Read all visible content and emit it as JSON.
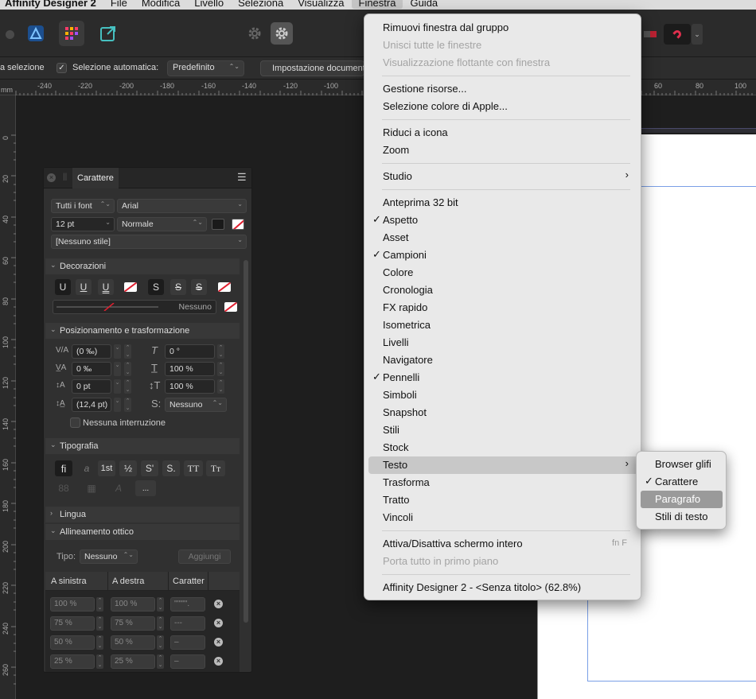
{
  "menubar": {
    "app": "Affinity Designer 2",
    "items": [
      "File",
      "Modifica",
      "Livello",
      "Seleziona",
      "Visualizza",
      "Finestra",
      "Guida"
    ]
  },
  "context_bar": {
    "selection_text": "a selezione",
    "auto_select_label": "Selezione automatica:",
    "auto_select_value": "Predefinito",
    "document_setup": "Impostazione documento"
  },
  "rulers": {
    "h_ticks": [
      "-240",
      "-220",
      "-200",
      "-180",
      "-160",
      "-140",
      "-120",
      "-100",
      "60",
      "80",
      "100"
    ],
    "v_ticks": [
      "0",
      "20",
      "40",
      "60",
      "80",
      "100",
      "120",
      "140",
      "160",
      "180",
      "200",
      "220",
      "240",
      "260"
    ],
    "unit": "mm"
  },
  "panel": {
    "title": "Carattere",
    "font_collection": "Tutti i font",
    "font_family": "Arial",
    "font_size": "12 pt",
    "font_style": "Normale",
    "style": "[Nessuno stile]",
    "sections": {
      "decorations": "Decorazioni",
      "positioning": "Posizionamento e trasformazione",
      "typography": "Tipografia",
      "language": "Lingua",
      "optical": "Allineamento ottico"
    },
    "decor": {
      "underline_buttons": [
        "U",
        "U",
        "U"
      ],
      "strike_buttons": [
        "S",
        "S",
        "S"
      ],
      "line_value": "Nessuno"
    },
    "positioning": {
      "kerning": "(0 ‰)",
      "italic_angle": "0 °",
      "tracking": "0 ‰",
      "v_scale": "100 %",
      "baseline": "0 pt",
      "h_scale": "100 %",
      "leading": "(12,4 pt)",
      "shear": "Nessuno",
      "no_break": "Nessuna interruzione"
    },
    "typography": {
      "buttons": [
        "fi",
        "a",
        "1st",
        "½",
        "S'",
        "S.",
        "TT",
        "Tт"
      ],
      "more": "..."
    },
    "optical": {
      "type_label": "Tipo:",
      "type_value": "Nessuno",
      "add": "Aggiungi",
      "columns": [
        "A sinistra",
        "A destra",
        "Caratter"
      ],
      "rows": [
        [
          "100 %",
          "100 %",
          "\"'\"'\"'."
        ],
        [
          "75 %",
          "75 %",
          "---"
        ],
        [
          "50 %",
          "50 %",
          "–"
        ],
        [
          "25 %",
          "25 %",
          "–"
        ]
      ]
    }
  },
  "menu": {
    "items": [
      {
        "label": "Rimuovi finestra dal gruppo"
      },
      {
        "label": "Unisci tutte le finestre",
        "disabled": true
      },
      {
        "label": "Visualizzazione flottante con finestra",
        "disabled": true
      },
      {
        "label": "Gestione risorse..."
      },
      {
        "label": "Selezione colore di Apple..."
      },
      {
        "label": "Riduci a icona"
      },
      {
        "label": "Zoom"
      },
      {
        "label": "Studio"
      },
      {
        "label": "Anteprima 32 bit"
      },
      {
        "label": "Aspetto"
      },
      {
        "label": "Asset"
      },
      {
        "label": "Campioni"
      },
      {
        "label": "Colore"
      },
      {
        "label": "Cronologia"
      },
      {
        "label": "FX rapido"
      },
      {
        "label": "Isometrica"
      },
      {
        "label": "Livelli"
      },
      {
        "label": "Navigatore"
      },
      {
        "label": "Pennelli"
      },
      {
        "label": "Simboli"
      },
      {
        "label": "Snapshot"
      },
      {
        "label": "Stili"
      },
      {
        "label": "Stock"
      },
      {
        "label": "Testo"
      },
      {
        "label": "Trasforma"
      },
      {
        "label": "Tratto"
      },
      {
        "label": "Vincoli"
      },
      {
        "label": "Attiva/Disattiva schermo intero",
        "shortcut": "fn F"
      },
      {
        "label": "Porta tutto in primo piano",
        "disabled": true
      },
      {
        "label": "Affinity Designer 2 - <Senza titolo> (62.8%)"
      }
    ],
    "check": "✓",
    "submenu_arrow": "›"
  },
  "submenu": {
    "items": [
      {
        "label": "Browser glifi"
      },
      {
        "label": "Carattere",
        "checked": true
      },
      {
        "label": "Paragrafo",
        "selected": true
      },
      {
        "label": "Stili di testo"
      }
    ]
  },
  "colors": {
    "menu_bg": "#e9e9e9",
    "highlight": "#c8c8c8",
    "guide": "#7a9fe6"
  }
}
